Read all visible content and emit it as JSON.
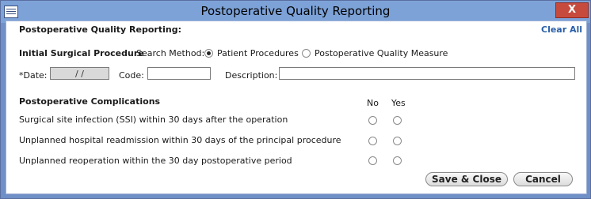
{
  "window": {
    "title": "Postoperative Quality Reporting",
    "close_symbol": "X",
    "app_icon": "table-icon"
  },
  "header": {
    "section_title": "Postoperative Quality Reporting:",
    "clear_all": "Clear All"
  },
  "procedure": {
    "title": "Initial Surgical Procedure",
    "search_method_label": "Search Method:",
    "options": [
      "Patient Procedures",
      "Postoperative Quality Measure"
    ],
    "selected_option": "Patient Procedures"
  },
  "fields": {
    "date_label": "*Date:",
    "date_value": "/ /",
    "code_label": "Code:",
    "code_value": "",
    "description_label": "Description:",
    "description_value": ""
  },
  "complications": {
    "title": "Postoperative Complications",
    "col_no": "No",
    "col_yes": "Yes",
    "rows": [
      "Surgical site infection (SSI) within 30 days after the operation",
      "Unplanned hospital readmission within 30 days of the principal procedure",
      "Unplanned reoperation within the 30 day postoperative period"
    ]
  },
  "buttons": {
    "save_close": "Save & Close",
    "cancel": "Cancel"
  }
}
